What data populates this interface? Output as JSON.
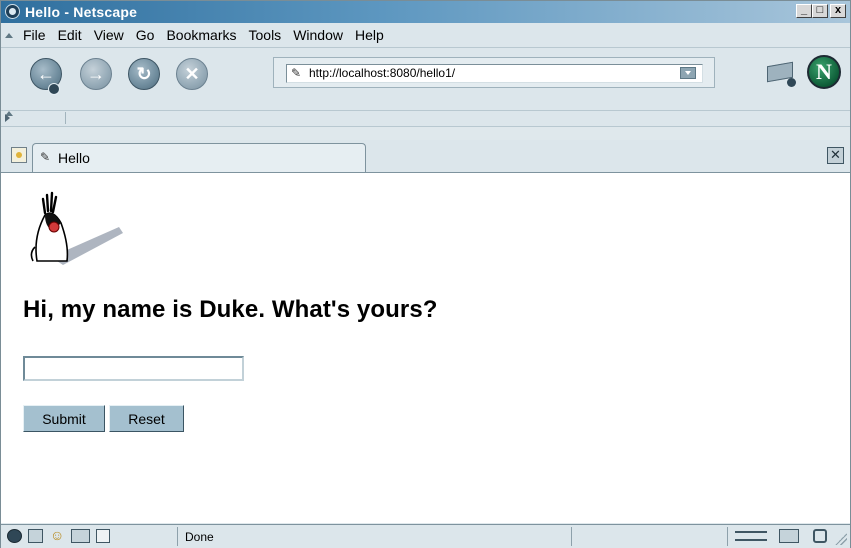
{
  "window": {
    "title": "Hello - Netscape",
    "controls": {
      "minimize": "_",
      "maximize": "□",
      "close": "x"
    }
  },
  "menubar": {
    "items": [
      {
        "label": "File"
      },
      {
        "label": "Edit"
      },
      {
        "label": "View"
      },
      {
        "label": "Go"
      },
      {
        "label": "Bookmarks"
      },
      {
        "label": "Tools"
      },
      {
        "label": "Window"
      },
      {
        "label": "Help"
      }
    ]
  },
  "navbar": {
    "back_icon": "back-arrow-icon",
    "forward_icon": "forward-arrow-icon",
    "reload_icon": "reload-icon",
    "stop_icon": "stop-icon",
    "url": "http://localhost:8080/hello1/",
    "print_icon": "print-icon",
    "logo_letter": "N"
  },
  "tabs": [
    {
      "label": "Hello",
      "active": true
    }
  ],
  "page": {
    "heading": "Hi, my name is Duke. What's yours?",
    "name_input": {
      "value": "",
      "placeholder": ""
    },
    "submit_label": "Submit",
    "reset_label": "Reset"
  },
  "statusbar": {
    "text": "Done"
  },
  "colors": {
    "titlebar_start": "#2f6f9e",
    "chrome": "#dce6eb",
    "button": "#a4c0cf"
  }
}
